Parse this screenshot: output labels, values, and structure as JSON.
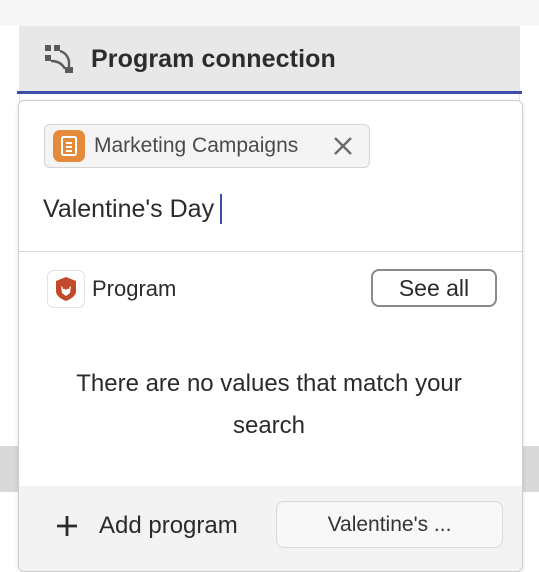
{
  "header": {
    "title": "Program connection",
    "icon": "hierarchy-icon"
  },
  "popover": {
    "tag": {
      "label": "Marketing Campaigns",
      "icon": "document-icon",
      "icon_color": "#E5893B",
      "close_icon": "close-icon"
    },
    "search": {
      "value": "Valentine's Day"
    },
    "category": {
      "label": "Program",
      "icon": "lion-icon",
      "see_all_label": "See all"
    },
    "empty_message": "There are no values that match your search",
    "footer": {
      "add_label": "Add program",
      "suggestion_label": "Valentine's ..."
    }
  },
  "colors": {
    "accent": "#3B4FA8",
    "tag_icon": "#E5893B",
    "program_icon": "#C24A2A"
  }
}
